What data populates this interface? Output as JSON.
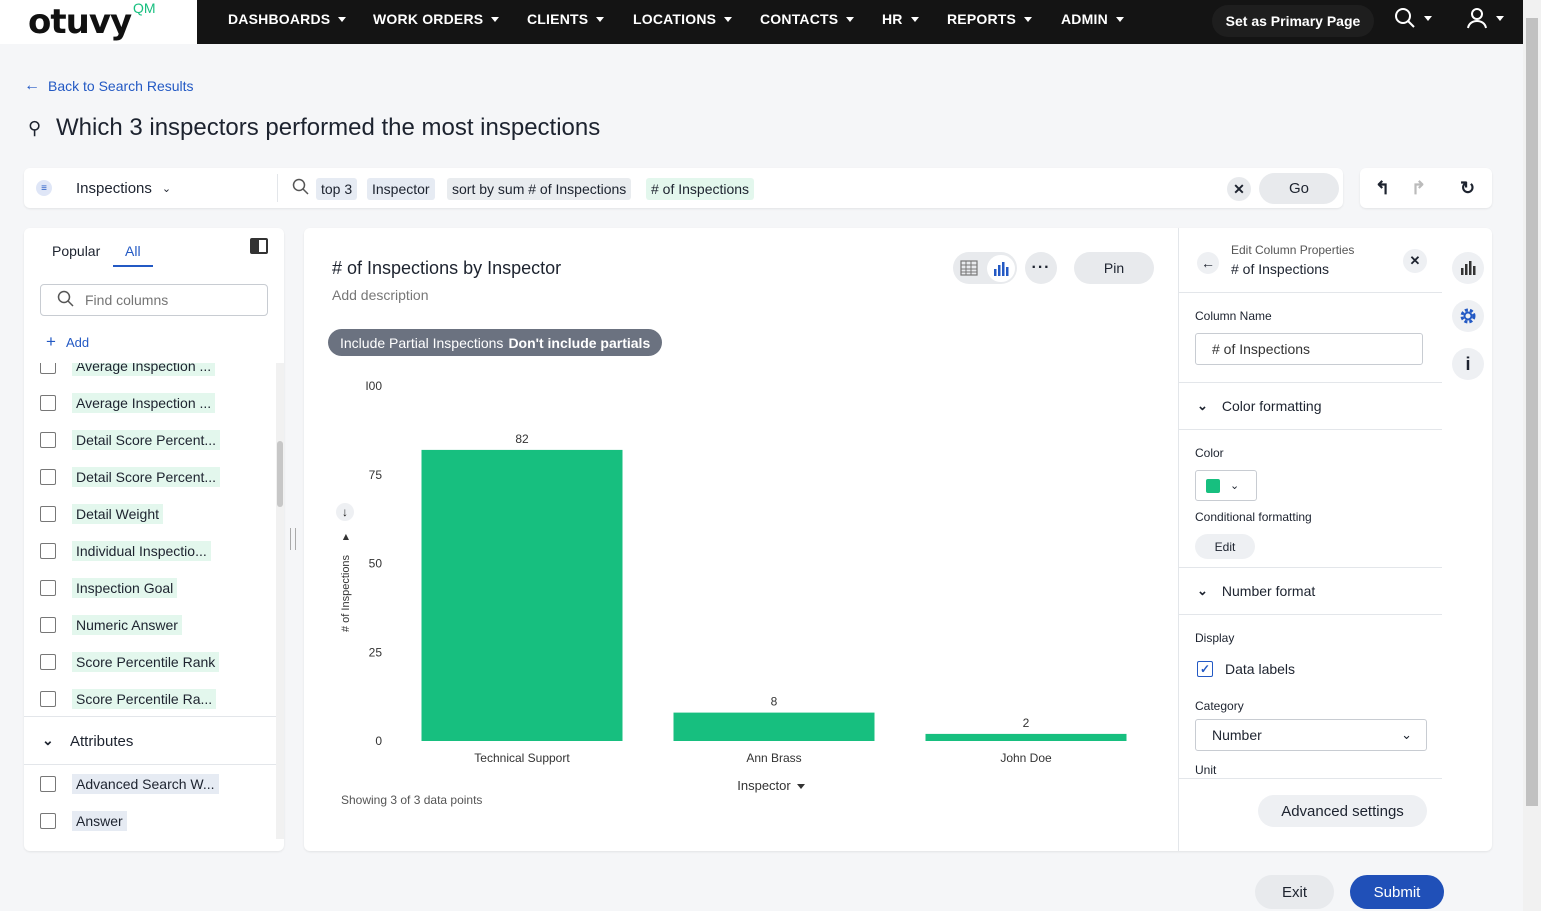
{
  "nav": {
    "logo": "otuvy",
    "logo_suffix": "QM",
    "items": [
      {
        "label": "DASHBOARDS"
      },
      {
        "label": "WORK ORDERS"
      },
      {
        "label": "CLIENTS"
      },
      {
        "label": "LOCATIONS"
      },
      {
        "label": "CONTACTS"
      },
      {
        "label": "HR"
      },
      {
        "label": "REPORTS"
      },
      {
        "label": "ADMIN"
      }
    ],
    "primary_button": "Set as Primary Page"
  },
  "header": {
    "back_link": "Back to Search Results",
    "title": "Which 3 inspectors performed the most inspections"
  },
  "searchbar": {
    "source": "Inspections",
    "tokens": [
      "top 3",
      "Inspector",
      "sort by sum # of Inspections",
      "# of Inspections"
    ],
    "go": "Go"
  },
  "leftpanel": {
    "tabs": [
      "Popular",
      "All"
    ],
    "active_tab": "All",
    "find_placeholder": "Find columns",
    "add_label": "Add",
    "columns": [
      "Average Inspection ...",
      "Average Inspection ...",
      "Detail Score Percent...",
      "Detail Score Percent...",
      "Detail Weight",
      "Individual Inspectio...",
      "Inspection Goal",
      "Numeric Answer",
      "Score Percentile Rank",
      "Score Percentile Ra..."
    ],
    "attributes_label": "Attributes",
    "attributes": [
      "Advanced Search W...",
      "Answer"
    ]
  },
  "chart_card": {
    "title": "# of Inspections by Inspector",
    "description": "Add description",
    "pin": "Pin",
    "filter_name": "Include Partial Inspections",
    "filter_value": "Don't include partials",
    "footer": "Showing 3 of 3 data points"
  },
  "chart_data": {
    "type": "bar",
    "categories": [
      "Technical Support",
      "Ann Brass",
      "John Doe"
    ],
    "values": [
      82,
      8,
      2
    ],
    "xlabel": "Inspector",
    "ylabel": "# of Inspections",
    "ylim": [
      0,
      100
    ],
    "yticks": [
      0,
      25,
      50,
      75,
      100
    ],
    "ytick_labels": [
      "0",
      "25",
      "50",
      "75",
      "I00"
    ],
    "color": "#17bf7f",
    "data_labels": true
  },
  "edit_panel": {
    "subtitle": "Edit Column Properties",
    "title": "# of Inspections",
    "column_name_label": "Column Name",
    "column_name_value": "# of Inspections",
    "color_formatting": "Color formatting",
    "color_label": "Color",
    "color_value": "#17bf7f",
    "conditional_formatting": "Conditional formatting",
    "edit": "Edit",
    "number_format": "Number format",
    "display_label": "Display",
    "data_labels": "Data labels",
    "category_label": "Category",
    "category_value": "Number",
    "unit_label": "Unit",
    "advanced": "Advanced settings"
  },
  "footer": {
    "exit": "Exit",
    "submit": "Submit"
  }
}
